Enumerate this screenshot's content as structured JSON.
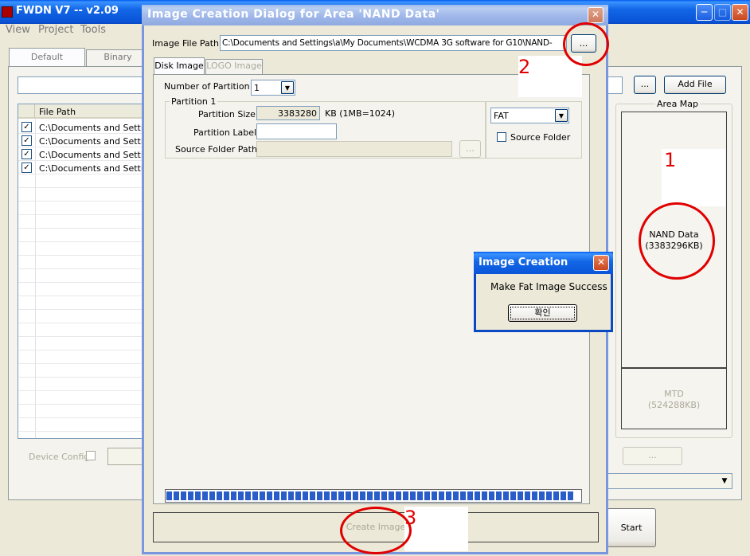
{
  "main_window": {
    "title": "FWDN V7 -- v2.09",
    "menu": [
      "View",
      "Project",
      "Tools"
    ],
    "tabs": [
      "Default",
      "Binary"
    ],
    "add_file_label": "Add File",
    "browse_label": "...",
    "file_list_header": "File Path",
    "file_rows": [
      "C:\\Documents and Setting",
      "C:\\Documents and Setting",
      "C:\\Documents and Setting",
      "C:\\Documents and Setting"
    ],
    "area_map_label": "Area Map",
    "nand_area": {
      "name": "NAND Data",
      "size": "(3383296KB)"
    },
    "mtd_area": {
      "name": "MTD",
      "size": "(524288KB)"
    },
    "device_config_label": "Device Config",
    "ellipsis_button": "...",
    "start_label": "Start"
  },
  "dialog": {
    "title": "Image Creation Dialog for Area 'NAND Data'",
    "image_file_path_label": "Image File Path:",
    "image_file_path_value": "C:\\Documents and Settings\\a\\My Documents\\WCDMA 3G software for G10\\NAND-",
    "browse_label": "...",
    "tabs": [
      "Disk Image",
      "LOGO Image"
    ],
    "number_of_partition_label": "Number of Partition",
    "number_of_partition_value": "1",
    "partition_group_label": "Partition 1",
    "partition_size_label": "Partition Size",
    "partition_size_value": "3383280",
    "partition_size_unit": "KB (1MB=1024)",
    "partition_label_label": "Partition Label",
    "source_folder_path_label": "Source Folder Path",
    "fs_value": "FAT",
    "source_folder_check_label": "Source Folder",
    "create_image_label": "Create Image",
    "progress_percent": 100
  },
  "message_box": {
    "title": "Image Creation",
    "message": "Make Fat Image Success",
    "ok_label": "확인"
  },
  "annotations": {
    "n1": "1",
    "n2": "2",
    "n3": "3",
    "color": "#E00000"
  }
}
